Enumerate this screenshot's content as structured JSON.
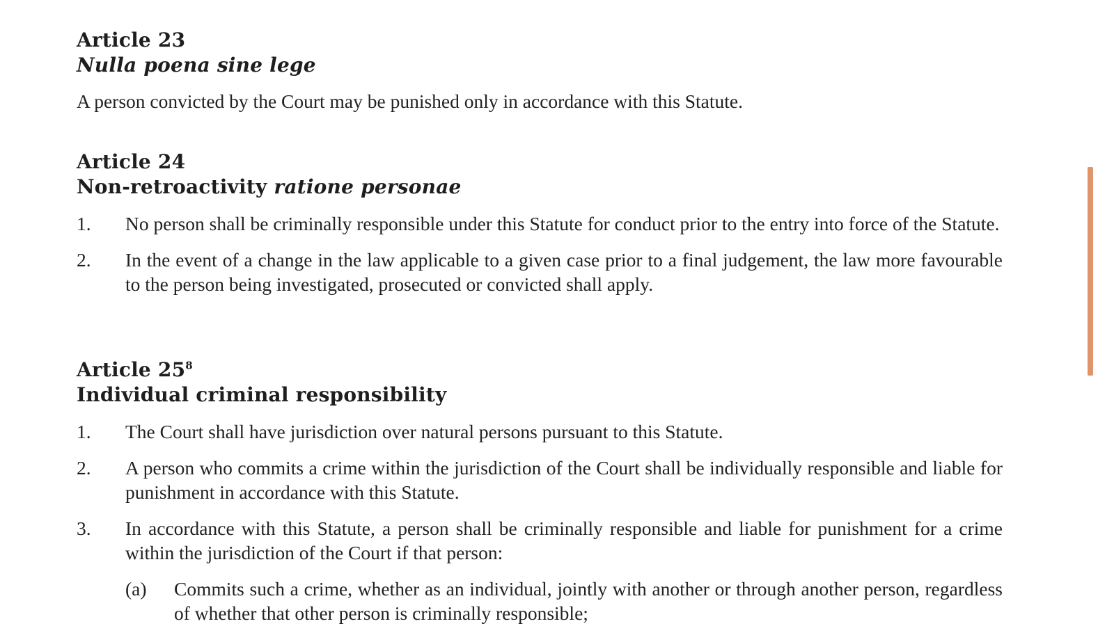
{
  "article23": {
    "number": "Article 23",
    "title": "Nulla poena sine lege",
    "text": "A person convicted by the Court may be punished only in accordance with this Statute."
  },
  "article24": {
    "number": "Article 24",
    "title_plain": "Non-retroactivity ",
    "title_italic": "ratione personae",
    "items": [
      {
        "num": "1.",
        "text": "No person shall be criminally responsible under this Statute for conduct prior to the entry into force of the Statute."
      },
      {
        "num": "2.",
        "text": "In the event of a change in the law applicable to a given case prior to a final judgement, the law more favourable to the person being investigated, prosecuted or convicted shall apply."
      }
    ]
  },
  "article25": {
    "number": "Article 25",
    "footnote": "8",
    "title": "Individual criminal responsibility",
    "items": [
      {
        "num": "1.",
        "text": "The Court shall have jurisdiction over natural persons pursuant to this Statute."
      },
      {
        "num": "2.",
        "text": "A person who commits a crime within the jurisdiction of the Court shall be individually responsible and liable for punishment in accordance with this Statute."
      },
      {
        "num": "3.",
        "text": "In accordance with this Statute, a person shall be criminally responsible and liable for punishment for a crime within the jurisdiction of the Court if that person:"
      }
    ],
    "subitems": [
      {
        "num": "(a)",
        "text": "Commits such a crime, whether as an individual, jointly with another or through another person, regardless of whether that other person is criminally responsible;"
      }
    ]
  },
  "colors": {
    "text": "#222222",
    "scroll_indicator": "#e0946c"
  }
}
